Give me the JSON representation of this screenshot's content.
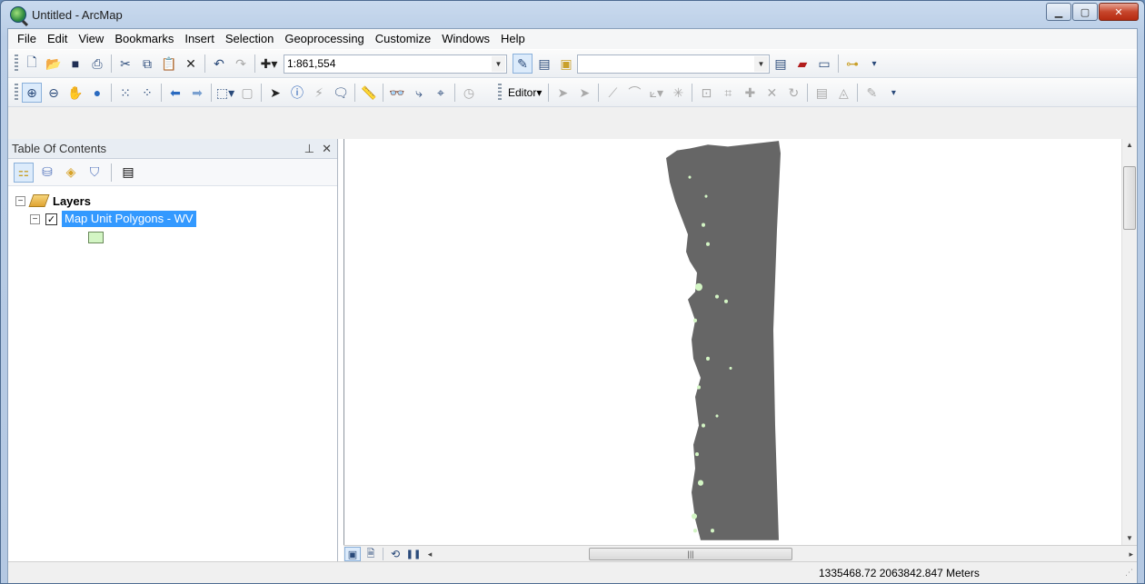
{
  "window": {
    "title": "Untitled - ArcMap"
  },
  "menu": [
    "File",
    "Edit",
    "View",
    "Bookmarks",
    "Insert",
    "Selection",
    "Geoprocessing",
    "Customize",
    "Windows",
    "Help"
  ],
  "toolbar": {
    "scale_value": "1:861,554",
    "editor_label": "Editor▾"
  },
  "toc": {
    "title": "Table Of Contents",
    "pin_label": "⊥ ✕",
    "root_label": "Layers",
    "layer_label": "Map Unit Polygons - WV",
    "layer_checked": true
  },
  "status": {
    "coordinates": "1335468.72  2063842.847 Meters"
  },
  "colors": {
    "polygon_fill": "#666666",
    "symbol_fill": "#d3f5c4",
    "selection": "#3399ff"
  }
}
